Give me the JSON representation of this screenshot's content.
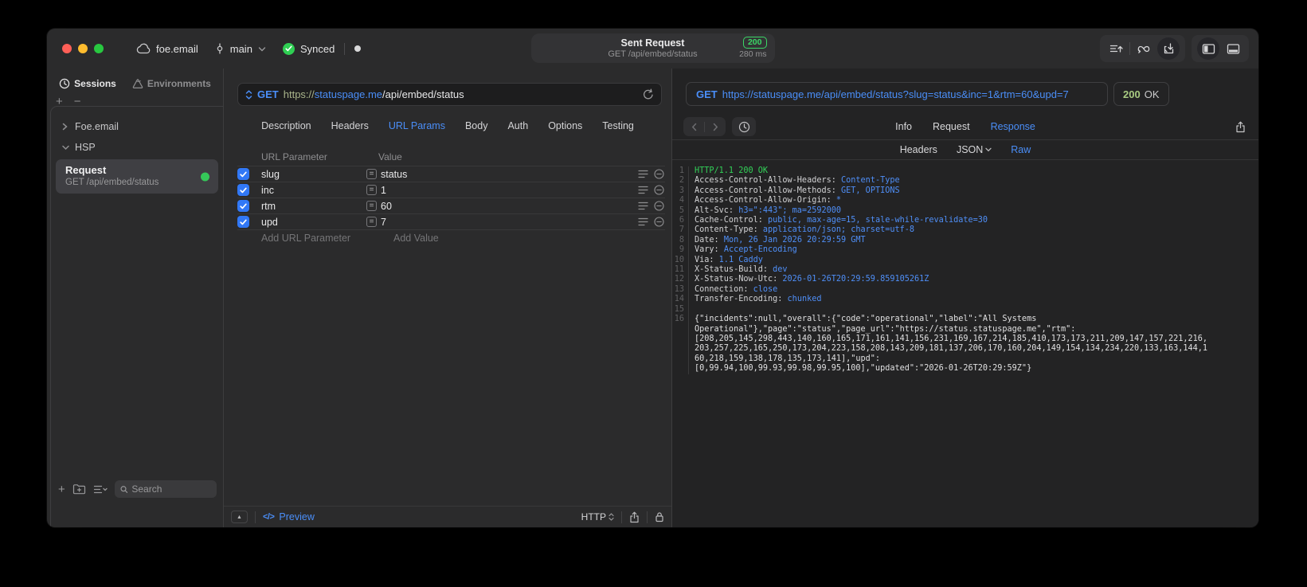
{
  "colors": {
    "accent_blue": "#4a8ef8",
    "success_green": "#32d158",
    "checkbox_blue": "#3178f6",
    "status_code_green": "#a9cc82"
  },
  "window": {
    "titlebar": {
      "project_name": "foe.email",
      "branch_name": "main",
      "sync_label": "Synced",
      "request_summary": {
        "title": "Sent Request",
        "subtitle": "GET /api/embed/status",
        "status_code": "200",
        "duration": "280 ms"
      }
    },
    "sidebar": {
      "tabs": [
        {
          "label": "Sessions",
          "active": true
        },
        {
          "label": "Environments",
          "active": false
        }
      ],
      "tree": {
        "groups": [
          {
            "label": "Foe.email",
            "expanded": false
          },
          {
            "label": "HSP",
            "expanded": true
          }
        ],
        "selected_request": {
          "title": "Request",
          "subtitle": "GET /api/embed/status"
        }
      },
      "search": {
        "placeholder": "Search"
      }
    },
    "request_editor": {
      "method": "GET",
      "url": {
        "scheme": "https://",
        "host": "statuspage.me",
        "path": "/api/embed/status"
      },
      "tabs": [
        "Description",
        "Headers",
        "URL Params",
        "Body",
        "Auth",
        "Options",
        "Testing"
      ],
      "active_tab": "URL Params",
      "params": {
        "columns": [
          "URL Parameter",
          "Value"
        ],
        "rows": [
          {
            "name": "slug",
            "value": "status",
            "checked": true
          },
          {
            "name": "inc",
            "value": "1",
            "checked": true
          },
          {
            "name": "rtm",
            "value": "60",
            "checked": true
          },
          {
            "name": "upd",
            "value": "7",
            "checked": true
          }
        ],
        "add_row": {
          "name_placeholder": "Add URL Parameter",
          "value_placeholder": "Add Value"
        }
      },
      "footer": {
        "preview_label": "Preview",
        "code_glyph": "</>",
        "protocol": "HTTP"
      }
    },
    "response_viewer": {
      "request_line": {
        "method": "GET",
        "url": "https://statuspage.me/api/embed/status?slug=status&inc=1&rtm=60&upd=7"
      },
      "status": {
        "code": "200",
        "text": "OK"
      },
      "tabs": [
        "Info",
        "Request",
        "Response"
      ],
      "active_tab": "Response",
      "subtabs": [
        {
          "label": "Headers",
          "has_menu": false
        },
        {
          "label": "JSON",
          "has_menu": true
        },
        {
          "label": "Raw",
          "has_menu": false
        }
      ],
      "active_subtab": "Raw",
      "response_lines": [
        {
          "type": "status",
          "text": "HTTP/1.1 200 OK"
        },
        {
          "type": "header",
          "name": "Access-Control-Allow-Headers",
          "value": "Content-Type"
        },
        {
          "type": "header",
          "name": "Access-Control-Allow-Methods",
          "value": "GET, OPTIONS"
        },
        {
          "type": "header",
          "name": "Access-Control-Allow-Origin",
          "value": "*"
        },
        {
          "type": "header",
          "name": "Alt-Svc",
          "value": "h3=\":443\"; ma=2592000"
        },
        {
          "type": "header",
          "name": "Cache-Control",
          "value": "public, max-age=15, stale-while-revalidate=30"
        },
        {
          "type": "header",
          "name": "Content-Type",
          "value": "application/json; charset=utf-8"
        },
        {
          "type": "header",
          "name": "Date",
          "value": "Mon, 26 Jan 2026 20:29:59 GMT"
        },
        {
          "type": "header",
          "name": "Vary",
          "value": "Accept-Encoding"
        },
        {
          "type": "header",
          "name": "Via",
          "value": "1.1 Caddy"
        },
        {
          "type": "header",
          "name": "X-Status-Build",
          "value": "dev"
        },
        {
          "type": "header",
          "name": "X-Status-Now-Utc",
          "value": "2026-01-26T20:29:59.859105261Z"
        },
        {
          "type": "header",
          "name": "Connection",
          "value": "close"
        },
        {
          "type": "header",
          "name": "Transfer-Encoding",
          "value": "chunked"
        },
        {
          "type": "blank"
        },
        {
          "type": "body",
          "wrapped": [
            "{\"incidents\":null,\"overall\":{\"code\":\"operational\",\"label\":\"All Systems",
            "Operational\"},\"page\":\"status\",\"page_url\":\"https://status.statuspage.me\",\"rtm\":",
            "[208,205,145,298,443,140,160,165,171,161,141,156,231,169,167,214,185,410,173,173,211,209,147,157,221,216,",
            "203,257,225,165,250,173,204,223,158,208,143,209,181,137,206,170,160,204,149,154,134,234,220,133,163,144,1",
            "60,218,159,138,178,135,173,141],\"upd\":",
            "[0,99.94,100,99.93,99.98,99.95,100],\"updated\":\"2026-01-26T20:29:59Z\"}"
          ]
        }
      ]
    }
  }
}
